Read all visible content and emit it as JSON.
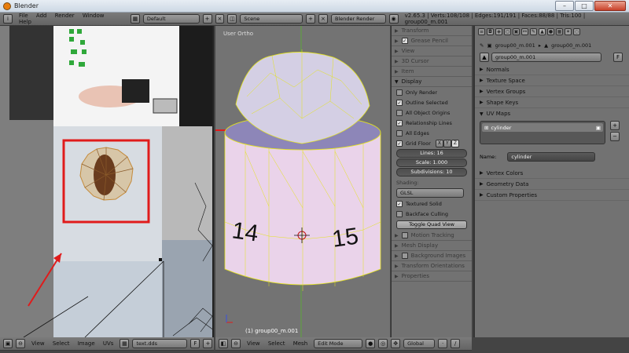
{
  "titlebar": {
    "title": "Blender"
  },
  "info_header": {
    "menu": [
      "File",
      "Add",
      "Render",
      "Window",
      "Help"
    ],
    "screen": "Default",
    "scene": "Scene",
    "engine": "Blender Render",
    "stats": "v2.65.3 | Verts:108/108 | Edges:191/191 | Faces:88/88 | Tris:100 | group00_m.001"
  },
  "uv_editor": {
    "menu": [
      "View",
      "Select",
      "Image",
      "UVs"
    ],
    "image_name": "text.dds",
    "fake_user": "F"
  },
  "viewport": {
    "label": "User Ortho",
    "object_label": "(1) group00_m.001",
    "menu": [
      "View",
      "Select",
      "Mesh"
    ],
    "mode": "Edit Mode",
    "orientation": "Global",
    "marks": [
      "14",
      "15"
    ]
  },
  "n_panel": {
    "sections": [
      "Transform",
      "Grease Pencil",
      "View",
      "3D Cursor",
      "Item"
    ],
    "display": "Display",
    "options": [
      {
        "label": "Only Render",
        "checked": false
      },
      {
        "label": "Outline Selected",
        "checked": true
      },
      {
        "label": "All Object Origins",
        "checked": false
      },
      {
        "label": "Relationship Lines",
        "checked": true
      },
      {
        "label": "All Edges",
        "checked": false
      }
    ],
    "grid_floor": "Grid Floor",
    "axes": [
      "X",
      "Y",
      "Z"
    ],
    "lines": "Lines: 16",
    "scale": "Scale: 1.000",
    "subdivisions": "Subdivisions: 10",
    "shading": "Shading:",
    "shading_mode": "GLSL",
    "textured_solid": "Textured Solid",
    "backface_culling": "Backface Culling",
    "toggle_quad": "Toggle Quad View",
    "bottom_sections": [
      "Motion Tracking",
      "Mesh Display",
      "Background Images",
      "Transform Orientations",
      "Properties"
    ]
  },
  "properties": {
    "breadcrumb_1": "group00_m.001",
    "breadcrumb_2": "group00_m.001",
    "datablock": "group00_m.001",
    "fake_user": "F",
    "sections_top": [
      "Normals",
      "Texture Space",
      "Vertex Groups",
      "Shape Keys"
    ],
    "uv_maps": "UV Maps",
    "uv_map_item": "cylinder",
    "name_label": "Name:",
    "name_value": "cylinder",
    "sections_bottom": [
      "Vertex Colors",
      "Geometry Data",
      "Custom Properties"
    ]
  },
  "colors": {
    "accent": "#e4e419",
    "selection": "#e8a35a",
    "annotation": "#e01b1b"
  }
}
